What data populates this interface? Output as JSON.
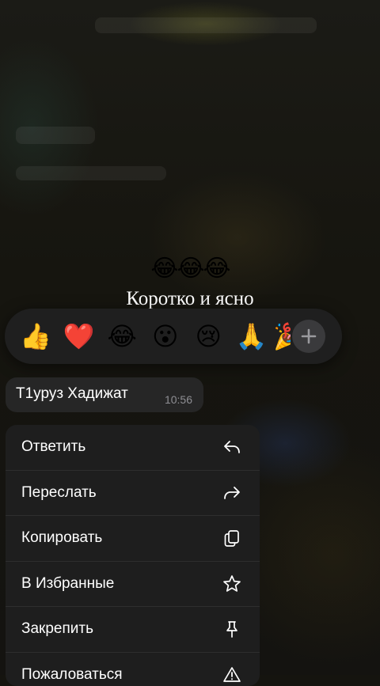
{
  "message": {
    "emoji_row": "😂😂😂",
    "caption": "Коротко и ясно"
  },
  "reactions": {
    "items": [
      "👍",
      "❤️",
      "😂",
      "😮",
      "😢",
      "🙏",
      "🎉"
    ],
    "add_icon": "plus-icon"
  },
  "preview": {
    "sender": "Т1уруз Хадижат",
    "time": "10:56"
  },
  "menu": {
    "items": [
      {
        "label": "Ответить",
        "icon": "reply-icon"
      },
      {
        "label": "Переслать",
        "icon": "forward-icon"
      },
      {
        "label": "Копировать",
        "icon": "copy-icon"
      },
      {
        "label": "В Избранные",
        "icon": "star-icon"
      },
      {
        "label": "Закрепить",
        "icon": "pin-icon"
      },
      {
        "label": "Пожаловаться",
        "icon": "warning-icon"
      }
    ]
  },
  "colors": {
    "menu_bg": "#1e1e1e",
    "bubble_bg": "#262626",
    "reaction_bar_bg": "#1f1f1f",
    "text_primary": "#ffffff",
    "text_secondary": "#8e8e93"
  }
}
